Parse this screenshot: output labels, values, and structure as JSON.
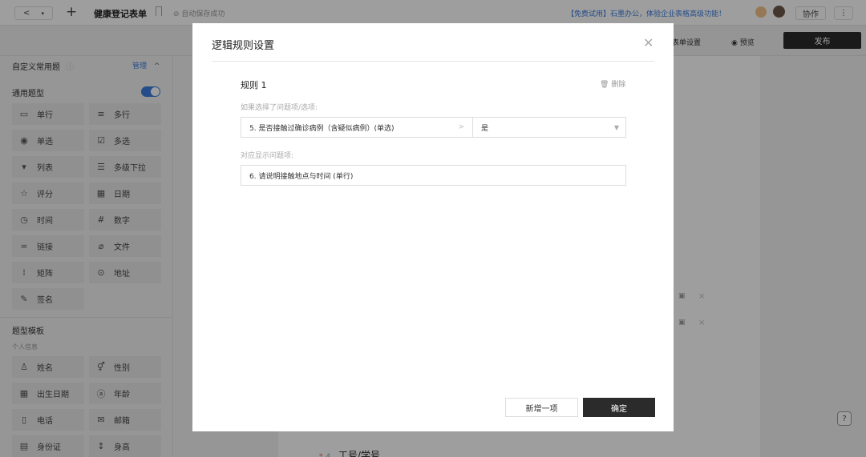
{
  "topbar": {
    "back_icon": "chevron-left-icon",
    "add_icon": "plus-icon",
    "doc_title": "健康登记表单",
    "save_status": "自动保存成功",
    "promo": "【免费试用】石墨办公，体验企业表格高级功能！",
    "collab_label": "协作",
    "more_icon": "more-vertical-icon"
  },
  "secondbar": {
    "form_settings": "表单设置",
    "preview": "预览",
    "publish": "发布"
  },
  "sidebar": {
    "custom_title": "自定义常用题",
    "manage": "管理",
    "general_title": "通用题型",
    "general_items": [
      {
        "label": "单行",
        "icon": "single-line-icon"
      },
      {
        "label": "多行",
        "icon": "multi-line-icon"
      },
      {
        "label": "单选",
        "icon": "radio-icon"
      },
      {
        "label": "多选",
        "icon": "checkbox-icon"
      },
      {
        "label": "列表",
        "icon": "list-icon"
      },
      {
        "label": "多级下拉",
        "icon": "cascade-icon"
      },
      {
        "label": "评分",
        "icon": "star-icon"
      },
      {
        "label": "日期",
        "icon": "calendar-icon"
      },
      {
        "label": "时间",
        "icon": "clock-icon"
      },
      {
        "label": "数字",
        "icon": "hash-icon"
      },
      {
        "label": "链接",
        "icon": "link-icon"
      },
      {
        "label": "文件",
        "icon": "paperclip-icon"
      },
      {
        "label": "矩阵",
        "icon": "grid-icon"
      },
      {
        "label": "地址",
        "icon": "location-icon"
      },
      {
        "label": "签名",
        "icon": "pen-icon"
      }
    ],
    "template_title": "题型模板",
    "personal_info": "个人信息",
    "template_items": [
      {
        "label": "姓名",
        "icon": "person-icon"
      },
      {
        "label": "性别",
        "icon": "gender-icon"
      },
      {
        "label": "出生日期",
        "icon": "calendar-icon"
      },
      {
        "label": "年龄",
        "icon": "age-icon"
      },
      {
        "label": "电话",
        "icon": "phone-icon"
      },
      {
        "label": "邮箱",
        "icon": "mail-icon"
      },
      {
        "label": "身份证",
        "icon": "id-card-icon"
      },
      {
        "label": "身高",
        "icon": "height-icon"
      }
    ]
  },
  "canvas": {
    "question_num": "4",
    "question_label": "工号/学号"
  },
  "modal": {
    "title": "逻辑规则设置",
    "rule_label": "规则 1",
    "delete_label": "删除",
    "if_hint": "如果选择了问题项/选项:",
    "question_select": "5. 是否接触过确诊病例（含疑似病例）(单选)",
    "option_select": "是",
    "show_hint": "对应显示问题项:",
    "target_question": "6. 请说明接触地点与时间 (单行)",
    "add_button": "新增一项",
    "ok_button": "确定"
  },
  "colors": {
    "accent": "#3b7ddd",
    "dark": "#2b2b2b"
  }
}
